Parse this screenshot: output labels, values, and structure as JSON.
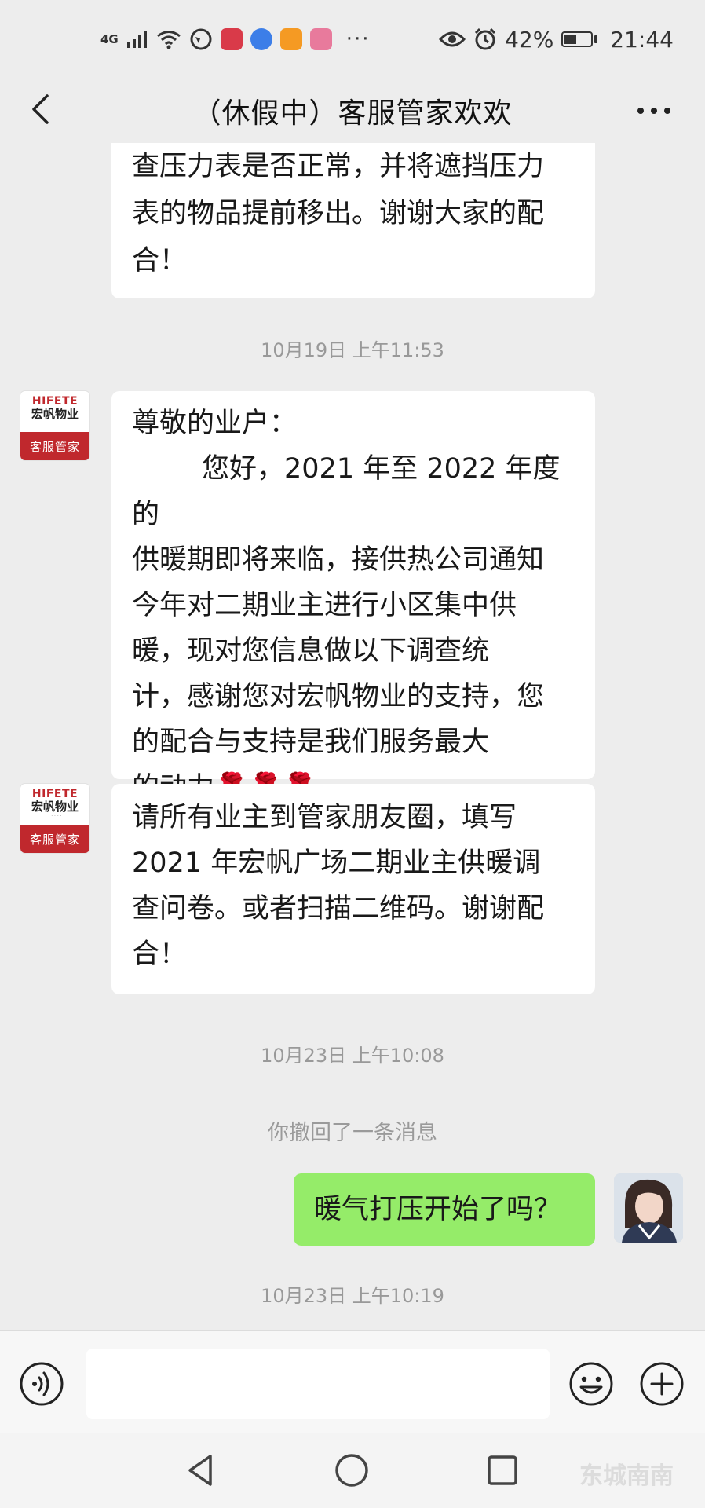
{
  "status_bar": {
    "network": "4G",
    "battery": "42%",
    "time": "21:44",
    "dots": "···",
    "app_icon_colors": [
      "#d93a49",
      "#3c7ee8",
      "#f59a23",
      "#e87a9c"
    ]
  },
  "header": {
    "title": "（休假中）客服管家欢欢"
  },
  "messages": [
    {
      "type": "text",
      "sender": "service",
      "text": "查压力表是否正常，并将遮挡压力\n表的物品提前移出。谢谢大家的配\n合！"
    },
    {
      "type": "time",
      "text": "10月19日 上午11:53"
    },
    {
      "type": "text",
      "sender": "service",
      "avatar_label": "客服管家",
      "avatar_brand_en": "HIFETE",
      "avatar_brand_cn": "宏帆物业",
      "text": "尊敬的业户：\n        您好，2021 年至 2022 年度的\n供暖期即将来临，接供热公司通知\n今年对二期业主进行小区集中供\n暖，现对您信息做以下调查统\n计，感谢您对宏帆物业的支持，您\n的配合与支持是我们服务最大\n的动力🌹🌹🌹。"
    },
    {
      "type": "text",
      "sender": "service",
      "avatar_label": "客服管家",
      "avatar_brand_en": "HIFETE",
      "avatar_brand_cn": "宏帆物业",
      "text": "请所有业主到管家朋友圈，填写\n2021 年宏帆广场二期业主供暖调\n查问卷。或者扫描二维码。谢谢配\n合！"
    },
    {
      "type": "time",
      "text": "10月23日 上午10:08"
    },
    {
      "type": "system",
      "text": "你撤回了一条消息"
    },
    {
      "type": "text",
      "sender": "me",
      "text": "暖气打压开始了吗？"
    },
    {
      "type": "time",
      "text": "10月23日 上午10:19"
    }
  ],
  "input_bar": {
    "placeholder": ""
  },
  "watermark": "东城南南"
}
